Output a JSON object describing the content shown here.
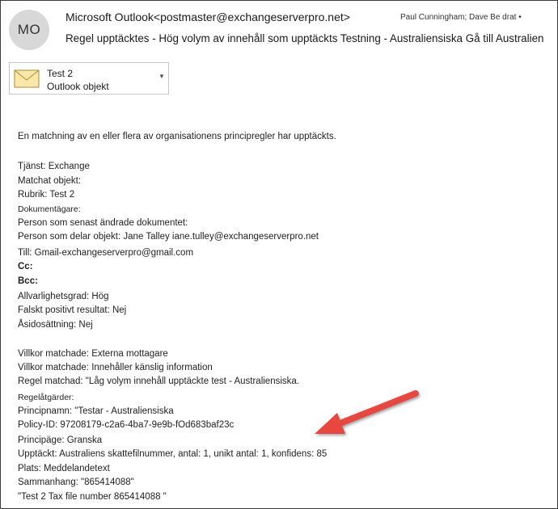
{
  "header": {
    "avatar_initials": "MO",
    "from": "Microsoft Outlook<postmaster@exchangeserverpro.net>",
    "recipients": "Paul Cunningham; Dave Be drat •",
    "subject": "Regel upptäcktes - Hög volym av innehåll som upptäckts Testning - Australiensiska Gå till Australien"
  },
  "attachment": {
    "icon": "envelope-icon",
    "name": "Test 2",
    "type": "Outlook objekt"
  },
  "body_lines": [
    "En matchning av en eller flera av organisationens principregler har upptäckts.",
    "Tjänst: Exchange",
    "Matchat objekt:",
    "Rubrik: Test 2",
    "Dokumentägare:",
    "Person som senast ändrade dokumentet:",
    "Person som delar objekt: Jane Talley iane.tulley@exchangeserverpro.net",
    "Till: Gmail-exchangeserverpro@gmail.com",
    "Cc:",
    "Bcc:",
    "Allvarlighetsgrad: Hög",
    "Falskt positivt resultat: Nej",
    "Åsidosättning: Nej",
    "Villkor matchade: Externa mottagare",
    "Villkor matchade: Innehåller känslig information",
    "Regel matchad: \"Låg volym innehåll upptäckte test - Australiensiska.",
    "Regelåtgärder:",
    "Principnamn: \"Testar - Australiensiska",
    "Policy-ID: 97208179-c2a6-4ba7-9e9b-fOd683baf23c",
    "Principäge: Granska",
    "Upptäckt: Australiens skattefilnummer, antal: 1, unikt antal: 1, konfidens: 85",
    "Plats: Meddelandetext",
    "Sammanhang: \"865414088\"",
    "\"Test 2 Tax file number 865414088 \""
  ],
  "colors": {
    "arrow": "#e8473f",
    "envelope_fill": "#fbe7a8",
    "envelope_stroke": "#b08a2e"
  }
}
